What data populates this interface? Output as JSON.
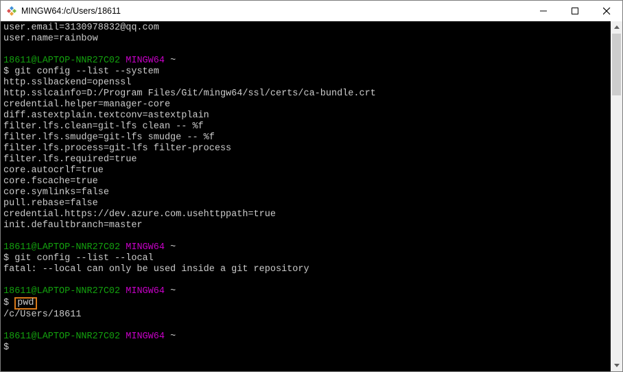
{
  "window": {
    "title": "MINGW64:/c/Users/18611"
  },
  "prompt": {
    "userhost": "18611@LAPTOP-NNR27C02",
    "env": "MINGW64",
    "tilde": "~",
    "dollar": "$"
  },
  "lines": {
    "l1": "user.email=3130978832@qq.com",
    "l2": "user.name=rainbow",
    "cmd1": "git config --list --system",
    "o1": "http.sslbackend=openssl",
    "o2": "http.sslcainfo=D:/Program Files/Git/mingw64/ssl/certs/ca-bundle.crt",
    "o3": "credential.helper=manager-core",
    "o4": "diff.astextplain.textconv=astextplain",
    "o5": "filter.lfs.clean=git-lfs clean -- %f",
    "o6": "filter.lfs.smudge=git-lfs smudge -- %f",
    "o7": "filter.lfs.process=git-lfs filter-process",
    "o8": "filter.lfs.required=true",
    "o9": "core.autocrlf=true",
    "o10": "core.fscache=true",
    "o11": "core.symlinks=false",
    "o12": "pull.rebase=false",
    "o13": "credential.https://dev.azure.com.usehttppath=true",
    "o14": "init.defaultbranch=master",
    "cmd2": "git config --list --local",
    "err1": "fatal: --local can only be used inside a git repository",
    "cmd3_boxed": "pwd",
    "out3": "/c/Users/18611"
  }
}
